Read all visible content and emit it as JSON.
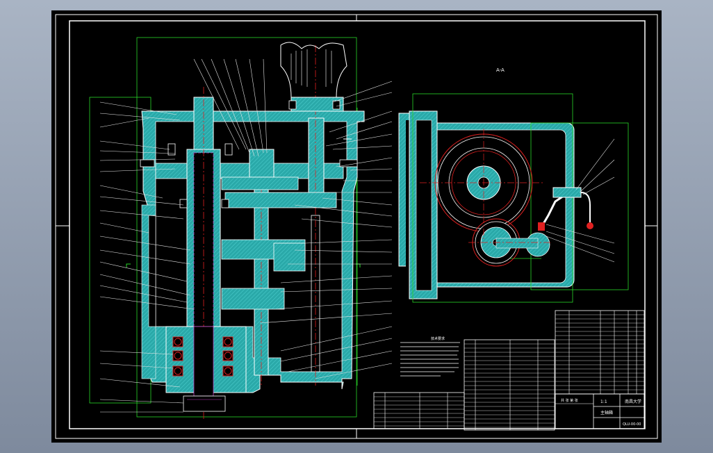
{
  "drawing": {
    "view_label": "A-A",
    "notes_title": "技术要求",
    "school": "南昌大学",
    "drawing_title": "主轴箱",
    "drawing_number": "QLU-00-00",
    "scale": "1:1",
    "sheet": "共 张 第 张"
  },
  "colors": {
    "background": "#000000",
    "frame": "#ffffff",
    "section_fill": "#2fb3b3",
    "outline": "#ffffff",
    "dimension": "#29d629",
    "centerline": "#e02020",
    "hidden": "#c040c0",
    "leader": "#e6e6e6"
  },
  "icons": [
    "crosshair-mark"
  ]
}
